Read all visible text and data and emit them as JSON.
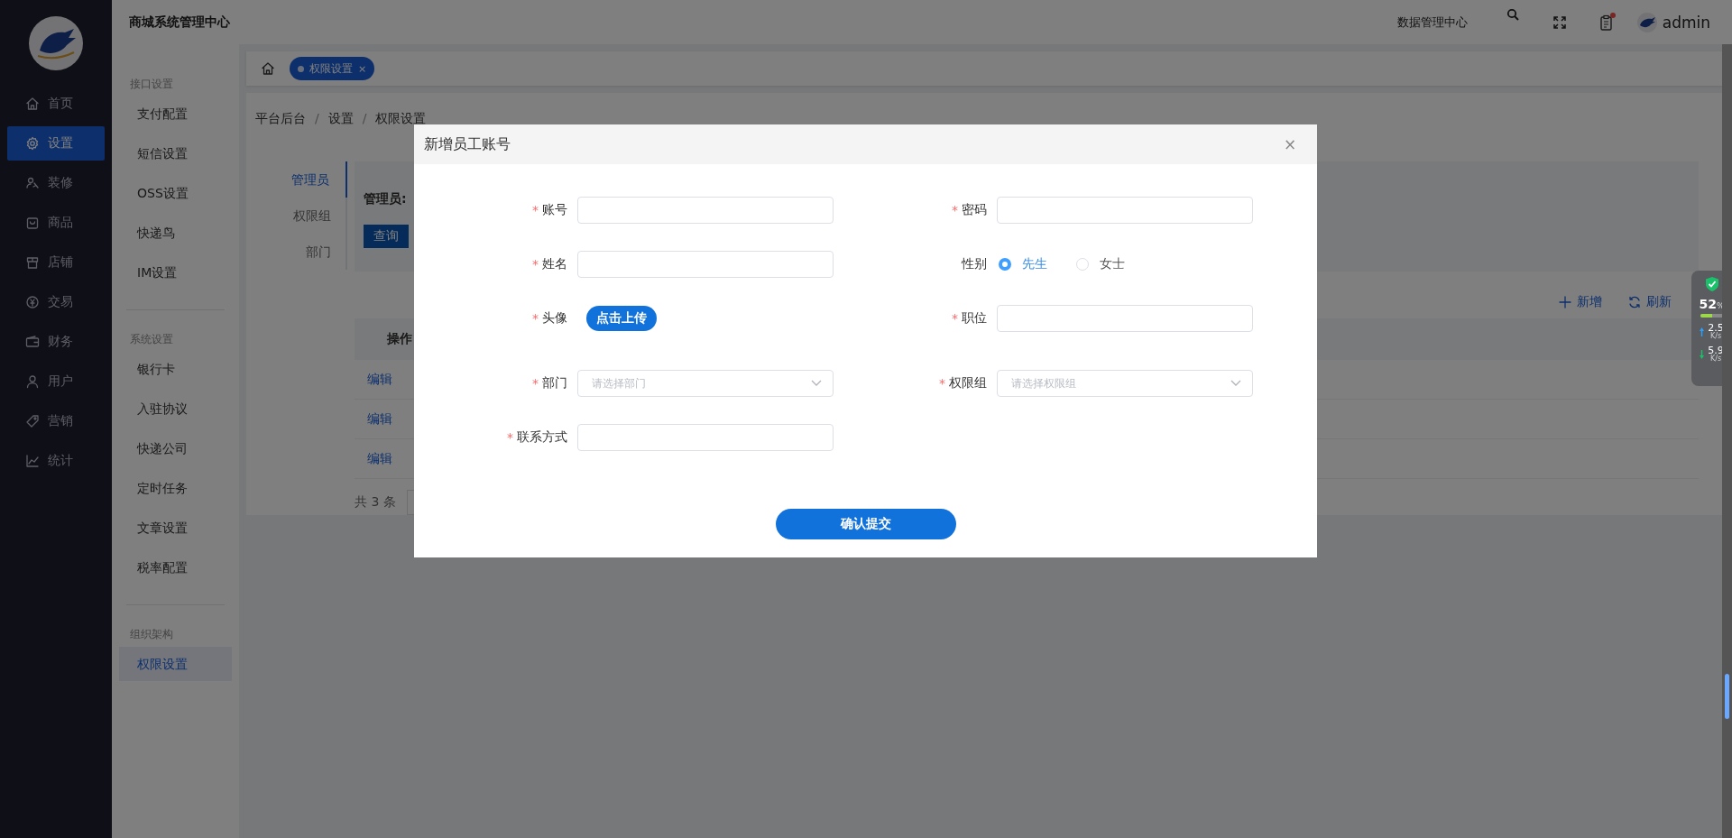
{
  "header": {
    "title": "商城系统管理中心",
    "data_center": "数据管理中心",
    "notice_dot": true,
    "user": "admin"
  },
  "main_menu": [
    {
      "label": "首页",
      "selected": false
    },
    {
      "label": "设置",
      "selected": true
    },
    {
      "label": "装修",
      "selected": false
    },
    {
      "label": "商品",
      "selected": false
    },
    {
      "label": "店铺",
      "selected": false
    },
    {
      "label": "交易",
      "selected": false
    },
    {
      "label": "财务",
      "selected": false
    },
    {
      "label": "用户",
      "selected": false
    },
    {
      "label": "营销",
      "selected": false
    },
    {
      "label": "统计",
      "selected": false
    }
  ],
  "sub_menu": [
    {
      "title": "接口设置",
      "items": [
        {
          "label": "支付配置",
          "selected": false
        },
        {
          "label": "短信设置",
          "selected": false
        },
        {
          "label": "OSS设置",
          "selected": false
        },
        {
          "label": "快递鸟",
          "selected": false
        },
        {
          "label": "IM设置",
          "selected": false
        }
      ]
    },
    {
      "title": "系统设置",
      "items": [
        {
          "label": "银行卡",
          "selected": false
        },
        {
          "label": "入驻协议",
          "selected": false
        },
        {
          "label": "快递公司",
          "selected": false
        },
        {
          "label": "定时任务",
          "selected": false
        },
        {
          "label": "文章设置",
          "selected": false
        },
        {
          "label": "税率配置",
          "selected": false
        }
      ]
    },
    {
      "title": "组织架构",
      "items": [
        {
          "label": "权限设置",
          "selected": true
        }
      ]
    }
  ],
  "page_tabs": [
    {
      "label": "权限设置",
      "close": "×",
      "selected": true
    }
  ],
  "breadcrumb": [
    {
      "kind": "item",
      "text": "平台后台"
    },
    {
      "kind": "separator",
      "text": "/"
    },
    {
      "kind": "item",
      "text": "设置"
    },
    {
      "kind": "separator",
      "text": "/"
    },
    {
      "kind": "item",
      "text": "权限设置"
    }
  ],
  "side_tabs": [
    {
      "label": "管理员",
      "selected": true
    },
    {
      "label": "权限组",
      "selected": false
    },
    {
      "label": "部门",
      "selected": false
    }
  ],
  "filter": {
    "label": "管理员:",
    "button": "查询"
  },
  "actions": [
    {
      "label": "新增"
    },
    {
      "label": "刷新"
    }
  ],
  "table": {
    "columns": [
      "操作"
    ],
    "rows": [
      [
        "编辑"
      ],
      [
        "编辑"
      ],
      [
        "编辑"
      ]
    ]
  },
  "pagination": {
    "total": "共 3 条"
  },
  "dialog": {
    "title": "新增员工账号",
    "close": "×",
    "fields": [
      {
        "label": "账号",
        "required_mark": "*",
        "kind": "text"
      },
      {
        "label": "密码",
        "required_mark": "*",
        "kind": "text"
      },
      {
        "label": "姓名",
        "required_mark": "*",
        "kind": "text"
      },
      {
        "label": "性别",
        "kind": "radio",
        "options": [
          {
            "label": "先生",
            "selected": true
          },
          {
            "label": "女士",
            "selected": false
          }
        ]
      },
      {
        "label": "头像",
        "required_mark": "*",
        "kind": "upload",
        "button": "点击上传"
      },
      {
        "label": "职位",
        "required_mark": "*",
        "kind": "text"
      },
      {
        "label": "部门",
        "required_mark": "*",
        "kind": "select",
        "placeholder": "请选择部门"
      },
      {
        "label": "权限组",
        "required_mark": "*",
        "kind": "select",
        "placeholder": "请选择权限组"
      },
      {
        "label": "联系方式",
        "required_mark": "*",
        "kind": "text"
      }
    ],
    "submit": "确认提交"
  },
  "monitor": {
    "percent": "52",
    "unit": "%",
    "level": 0.52,
    "upload": "2.5",
    "upload_unit": "K/s",
    "download": "5.9",
    "download_unit": "K/s"
  }
}
